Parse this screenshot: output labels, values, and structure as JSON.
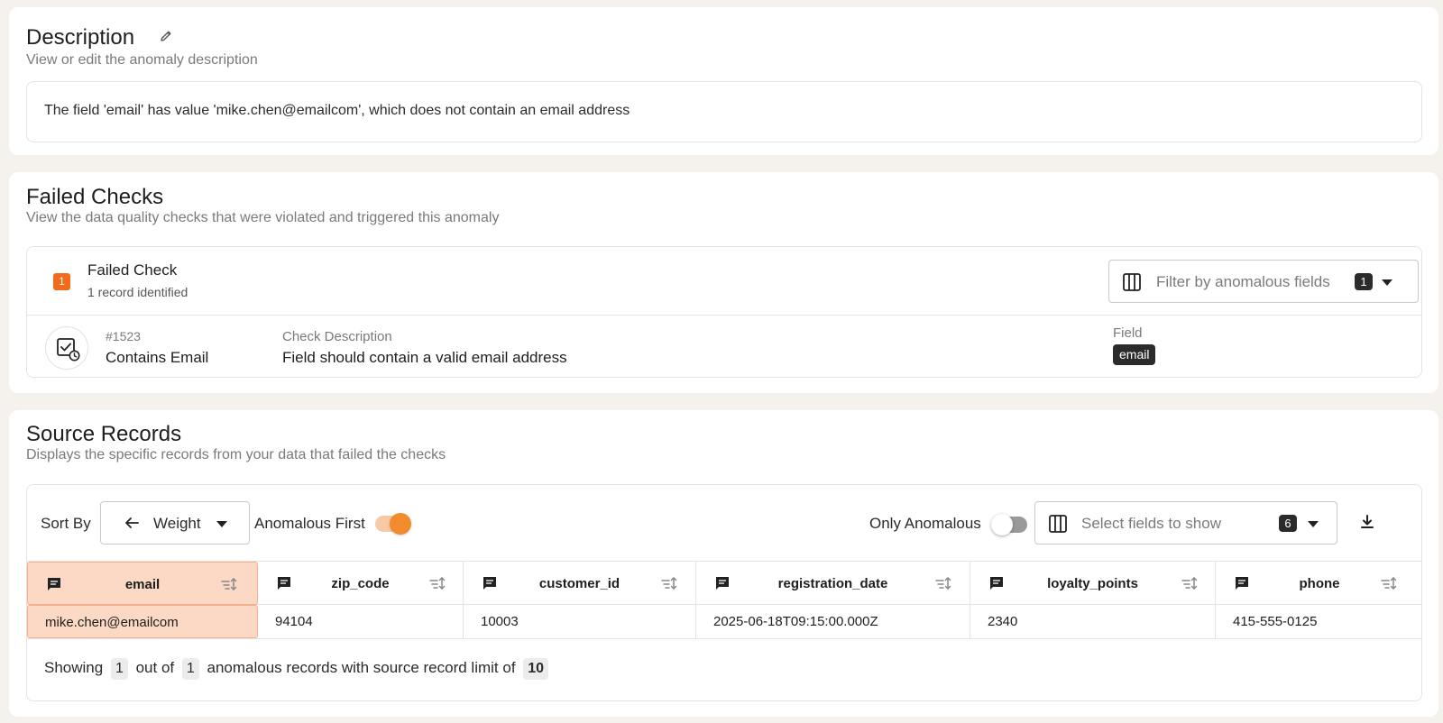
{
  "description": {
    "title": "Description",
    "subtitle": "View or edit the anomaly description",
    "text": "The field 'email' has value 'mike.chen@emailcom', which does not contain an email address"
  },
  "failed_checks": {
    "title": "Failed Checks",
    "subtitle": "View the data quality checks that were violated and triggered this anomaly",
    "count": "1",
    "header_title": "Failed Check",
    "header_sub": "1 record identified",
    "filter_placeholder": "Filter by anomalous fields",
    "filter_count": "1",
    "check": {
      "id": "#1523",
      "name": "Contains Email",
      "desc_label": "Check Description",
      "desc": "Field should contain a valid email address",
      "field_label": "Field",
      "field": "email"
    }
  },
  "source_records": {
    "title": "Source Records",
    "subtitle": "Displays the specific records from your data that failed the checks",
    "sort_label": "Sort By",
    "sort_value": "Weight",
    "anomalous_first_label": "Anomalous First",
    "anomalous_first_on": true,
    "only_anomalous_label": "Only Anomalous",
    "only_anomalous_on": false,
    "fields_placeholder": "Select fields to show",
    "fields_count": "6",
    "columns": [
      "email",
      "zip_code",
      "customer_id",
      "registration_date",
      "loyalty_points",
      "phone"
    ],
    "rows": [
      [
        "mike.chen@emailcom",
        "94104",
        "10003",
        "2025-06-18T09:15:00.000Z",
        "2340",
        "415-555-0125"
      ]
    ],
    "highlighted_column": "email",
    "footer": {
      "showing": "Showing",
      "shown": "1",
      "out_of": "out of",
      "total": "1",
      "mid": "anomalous records with source record limit of",
      "limit": "10"
    }
  },
  "colors": {
    "accent": "#f28b2e",
    "badge": "#f26b1d",
    "highlight": "#fbd9c4"
  }
}
